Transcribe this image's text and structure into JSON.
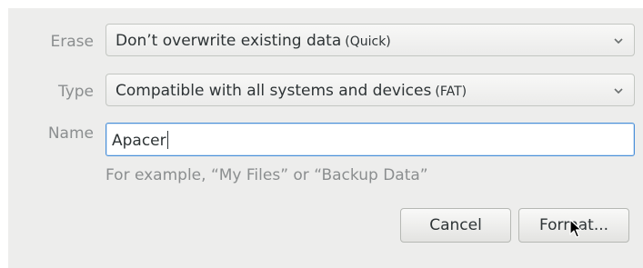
{
  "form": {
    "erase": {
      "label": "Erase",
      "value": "Don’t overwrite existing data",
      "detail": "(Quick)"
    },
    "type": {
      "label": "Type",
      "value": "Compatible with all systems and devices",
      "detail": "(FAT)"
    },
    "name": {
      "label": "Name",
      "value": "Apacer",
      "hint": "For example, “My Files” or “Backup Data”"
    }
  },
  "buttons": {
    "cancel": "Cancel",
    "format": "Format..."
  },
  "icons": {
    "dropdown": "chevron-down-icon",
    "pointer": "mouse-pointer-icon"
  },
  "colors": {
    "dialog_bg": "#ededec",
    "label": "#8b8e8f",
    "focus_border": "#4a90d9"
  }
}
